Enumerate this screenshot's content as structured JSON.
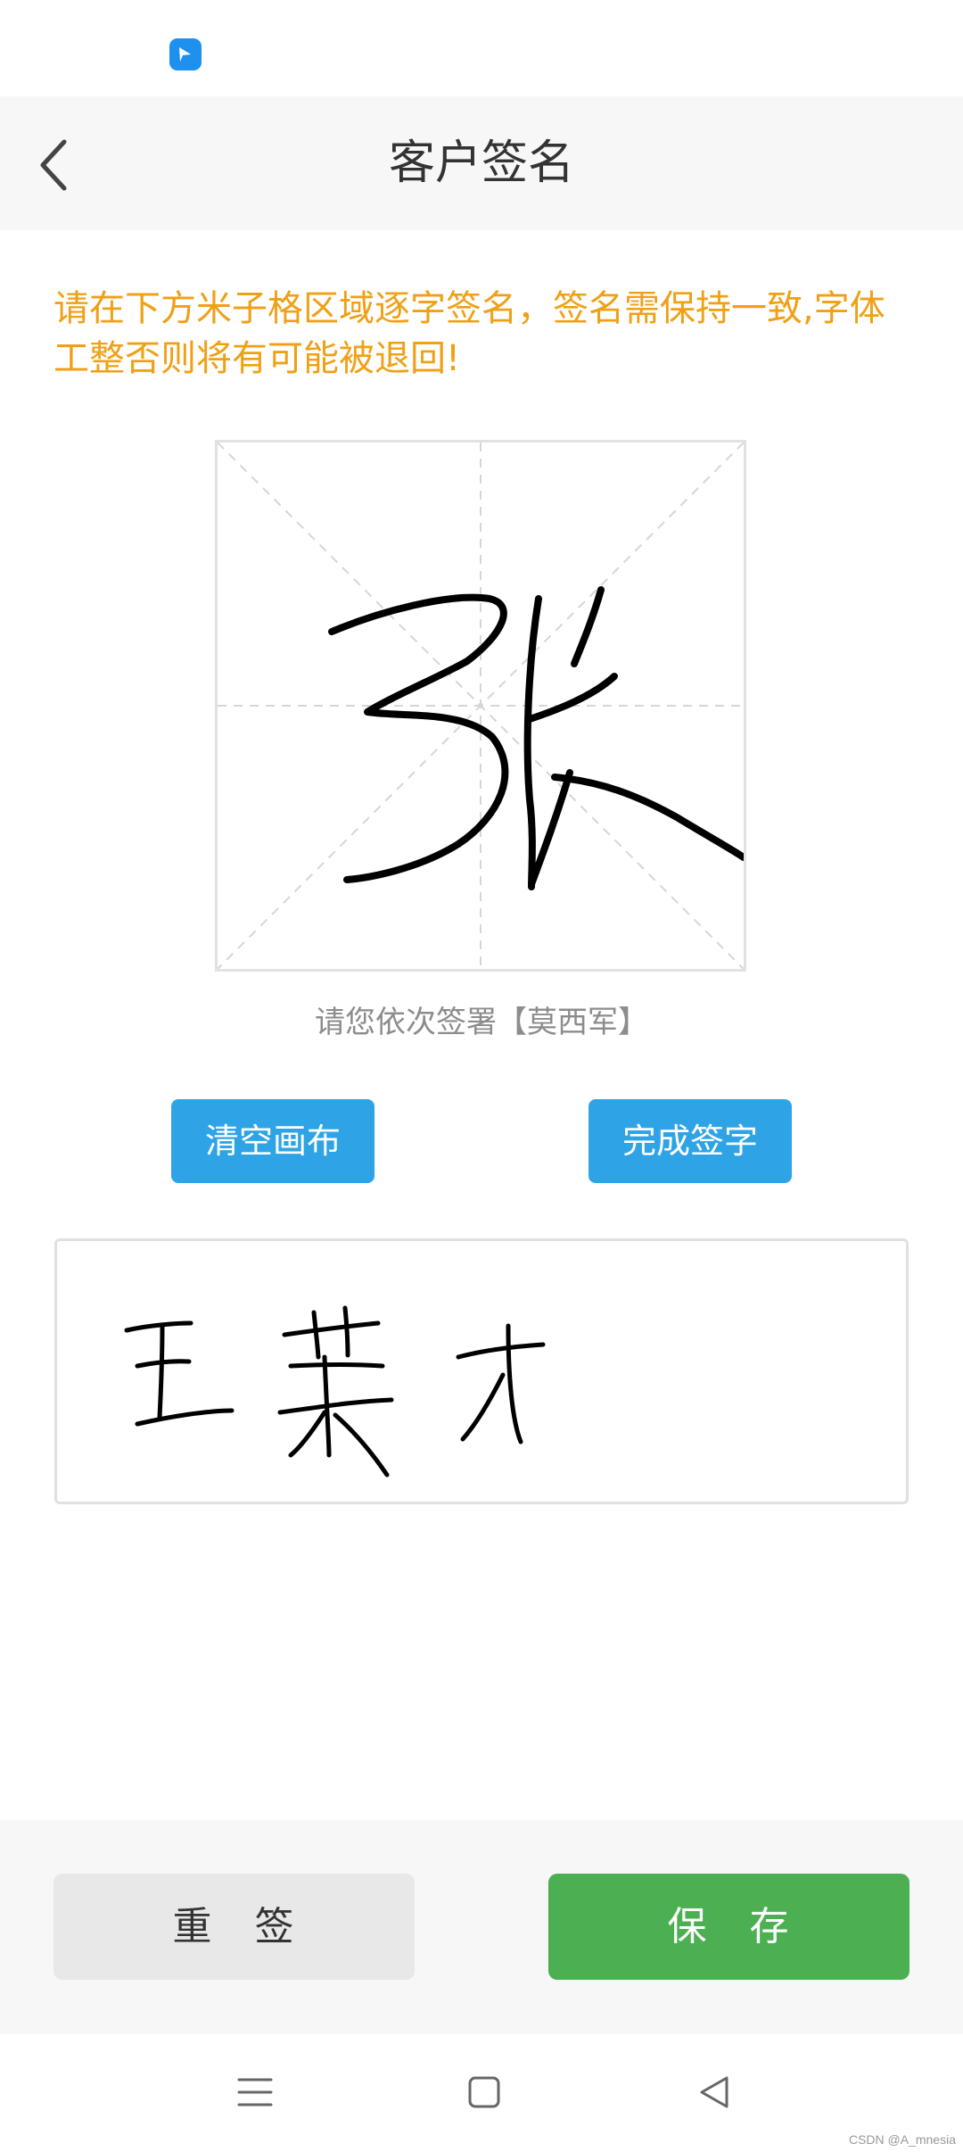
{
  "status_bar": {
    "app_icon": "feishu-app-icon"
  },
  "header": {
    "back_icon": "chevron-left-icon",
    "title": "客户签名"
  },
  "instructions": "请在下方米子格区域逐字签名，签名需保持一致,字体工整否则将有可能被退回!",
  "canvas": {
    "grid": "mi-zi-grid",
    "prompt": "请您依次签署【莫西军】"
  },
  "buttons": {
    "clear_label": "清空画布",
    "done_label": "完成签字"
  },
  "footer": {
    "resign_label": "重　签",
    "save_label": "保　存"
  },
  "nav": {
    "menu_icon": "menu-icon",
    "home_icon": "square-home-icon",
    "back_icon": "triangle-back-icon"
  },
  "watermark": "CSDN @A_mnesia",
  "colors": {
    "instruction": "#f0a015",
    "accent_blue": "#2ea4e6",
    "save_green": "#4cb052",
    "resign_gray": "#e8e8e8"
  }
}
